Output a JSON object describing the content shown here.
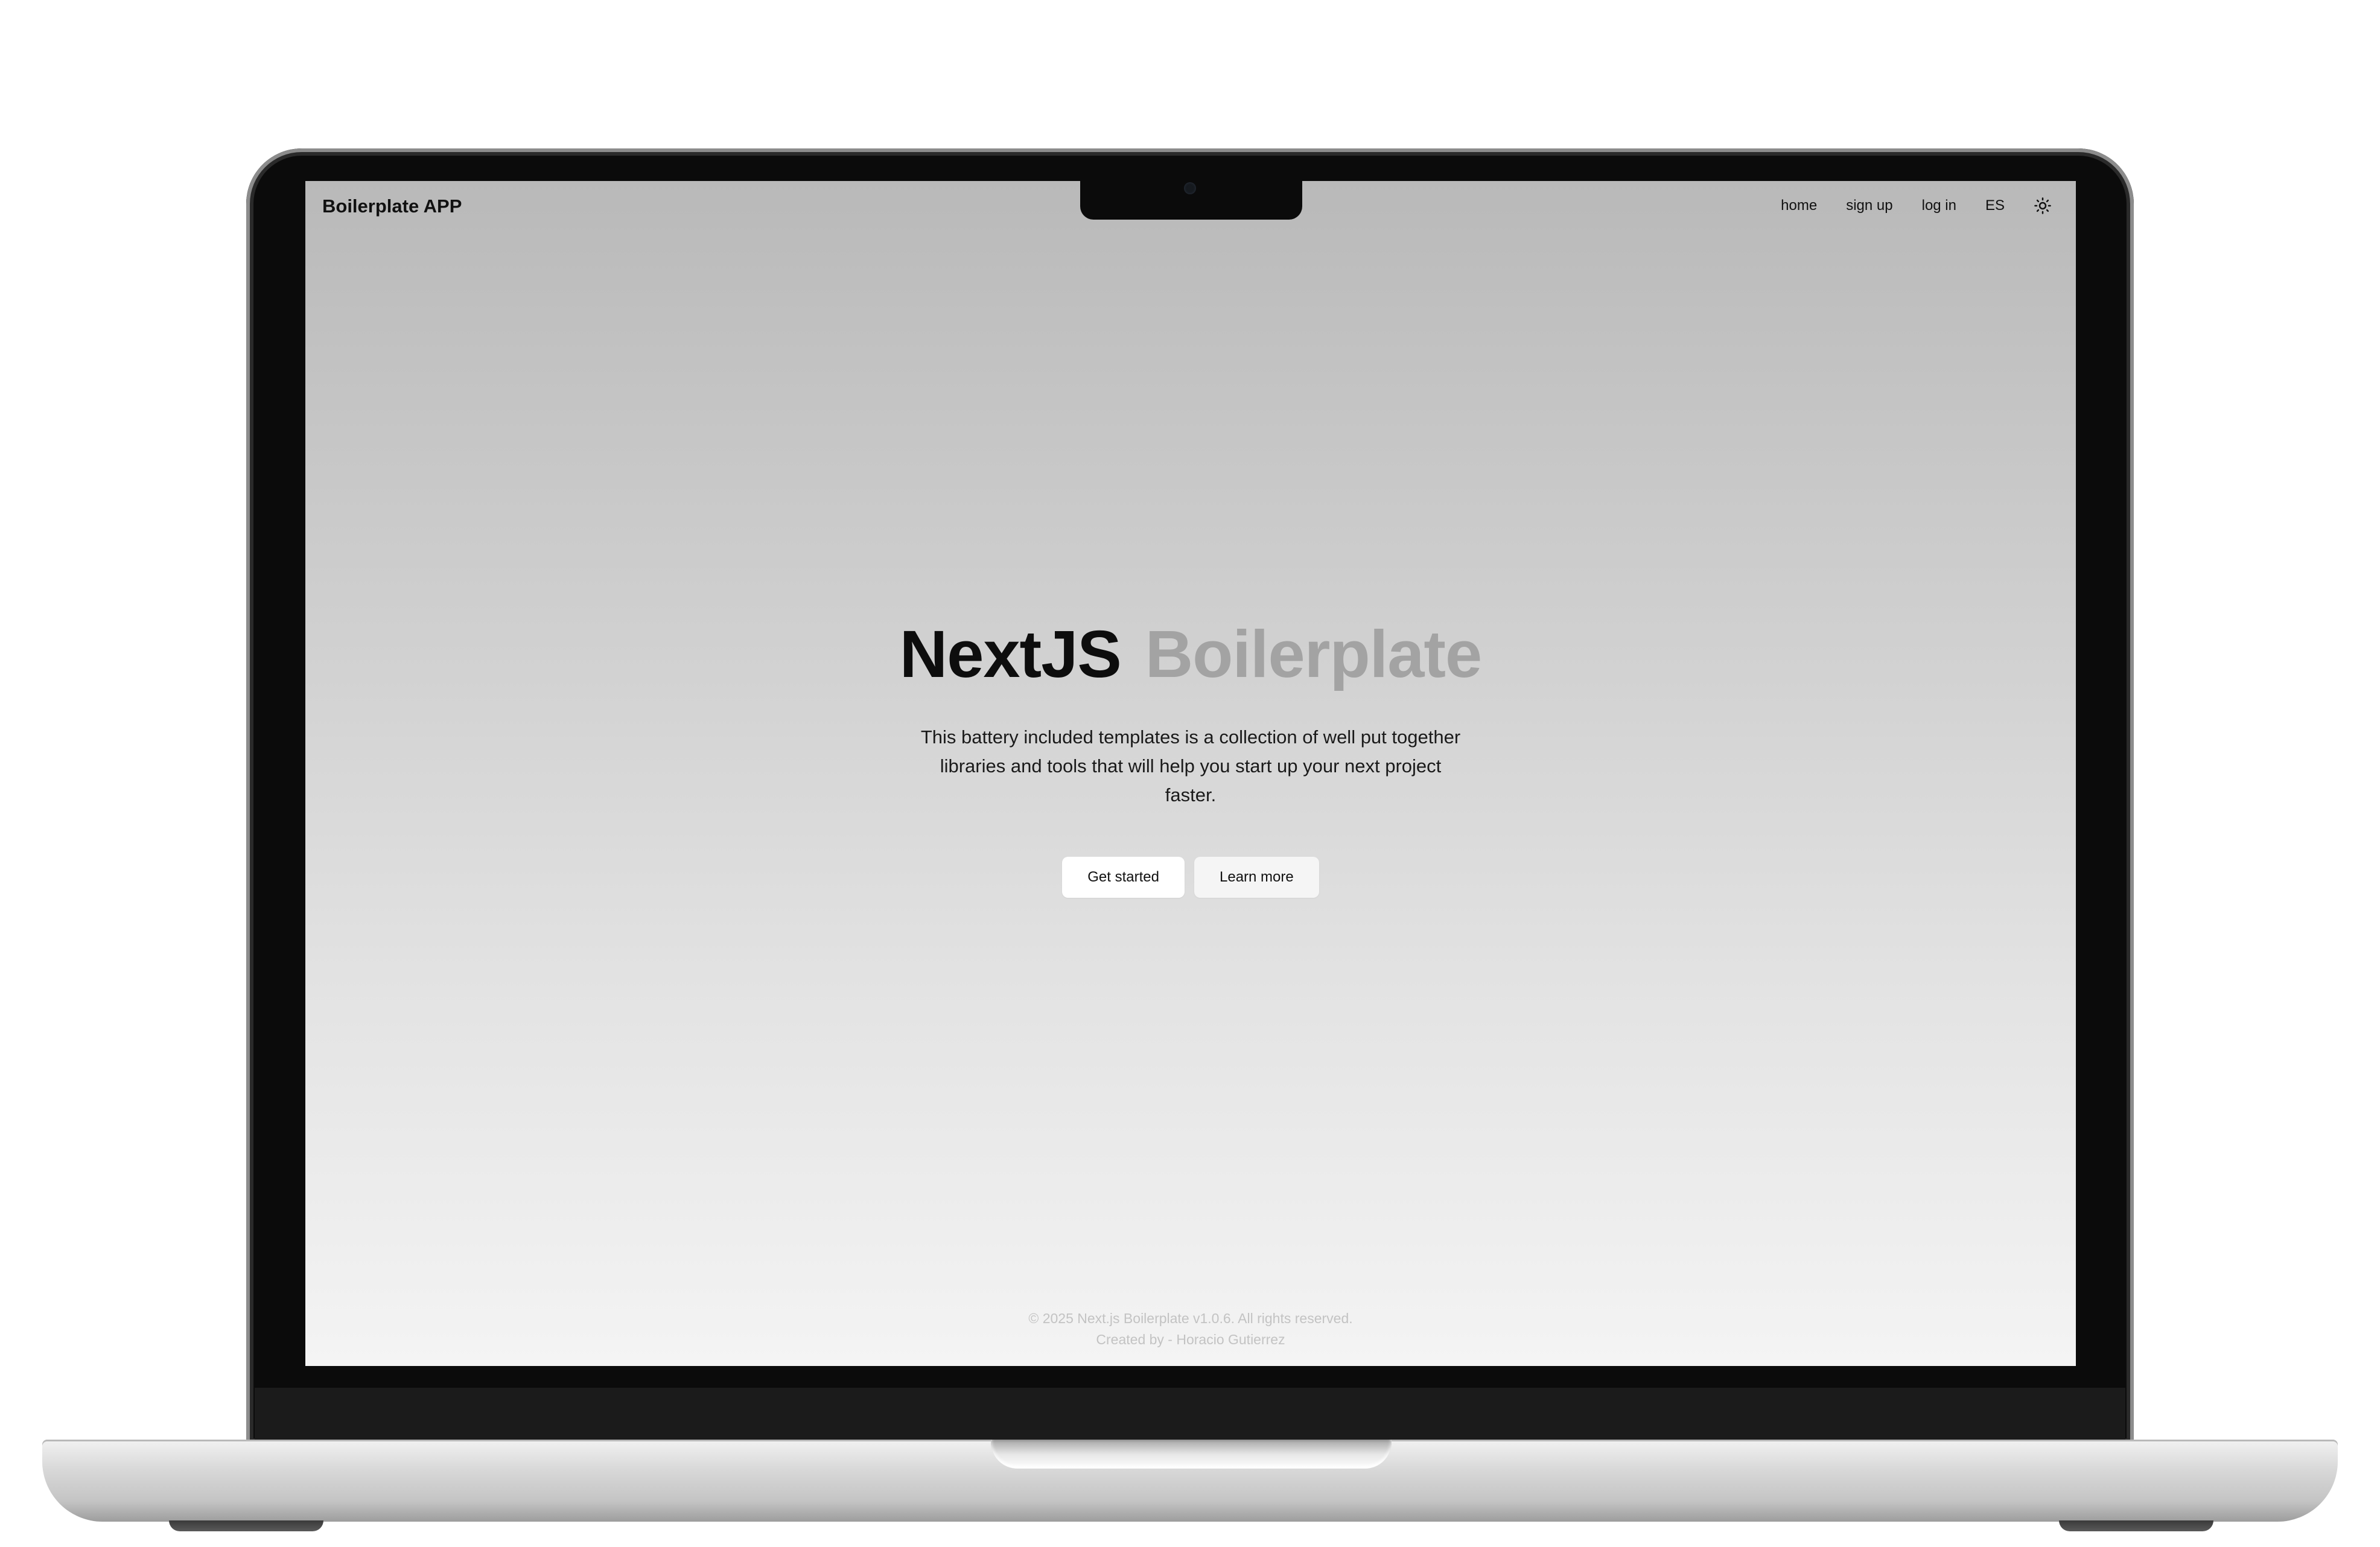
{
  "header": {
    "brand": "Boilerplate APP",
    "nav": [
      {
        "label": "home"
      },
      {
        "label": "sign up"
      },
      {
        "label": "log in"
      },
      {
        "label": "ES"
      }
    ],
    "theme_icon": "sun-icon"
  },
  "hero": {
    "title_primary": "NextJS",
    "title_secondary": "Boilerplate",
    "description": "This battery included templates is a collection of well put together libraries and tools that will help you start up your next project faster.",
    "primary_button": "Get started",
    "secondary_button": "Learn more"
  },
  "footer": {
    "copyright": "© 2025 Next.js Boilerplate v1.0.6. All rights reserved.",
    "credit": "Created by - Horacio Gutierrez"
  },
  "colors": {
    "title_primary": "#0d0d0d",
    "title_secondary": "#a3a3a3",
    "background_top": "#b9b9b9",
    "background_bottom": "#f4f4f4",
    "footer_text": "#c3c3c3"
  }
}
